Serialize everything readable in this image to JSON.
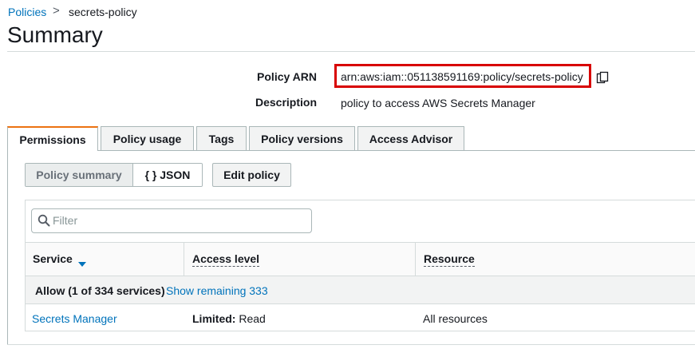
{
  "breadcrumb": {
    "parent": "Policies",
    "separator": ">",
    "current": "secrets-policy"
  },
  "page": {
    "title": "Summary"
  },
  "summary": {
    "arn_label": "Policy ARN",
    "arn_value": "arn:aws:iam::051138591169:policy/secrets-policy",
    "description_label": "Description",
    "description_value": "policy to access AWS Secrets Manager",
    "highlight_color": "#d80000"
  },
  "tabs": [
    {
      "label": "Permissions",
      "active": true
    },
    {
      "label": "Policy usage",
      "active": false
    },
    {
      "label": "Tags",
      "active": false
    },
    {
      "label": "Policy versions",
      "active": false
    },
    {
      "label": "Access Advisor",
      "active": false
    }
  ],
  "view_toggle": {
    "summary_label": "Policy summary",
    "json_label": "{ } JSON",
    "selected": "Policy summary"
  },
  "actions": {
    "edit_label": "Edit policy"
  },
  "filter": {
    "placeholder": "Filter",
    "value": ""
  },
  "table": {
    "columns": [
      "Service",
      "Access level",
      "Resource"
    ],
    "sort_column": "Service",
    "group": {
      "label": "Allow (1 of 334 services)",
      "link": "Show remaining 333"
    },
    "rows": [
      {
        "service": "Secrets Manager",
        "access_level_bold": "Limited:",
        "access_level_rest": " Read",
        "resource": "All resources"
      }
    ]
  },
  "colors": {
    "link": "#0073bb",
    "active_tab_accent": "#ec7211"
  }
}
